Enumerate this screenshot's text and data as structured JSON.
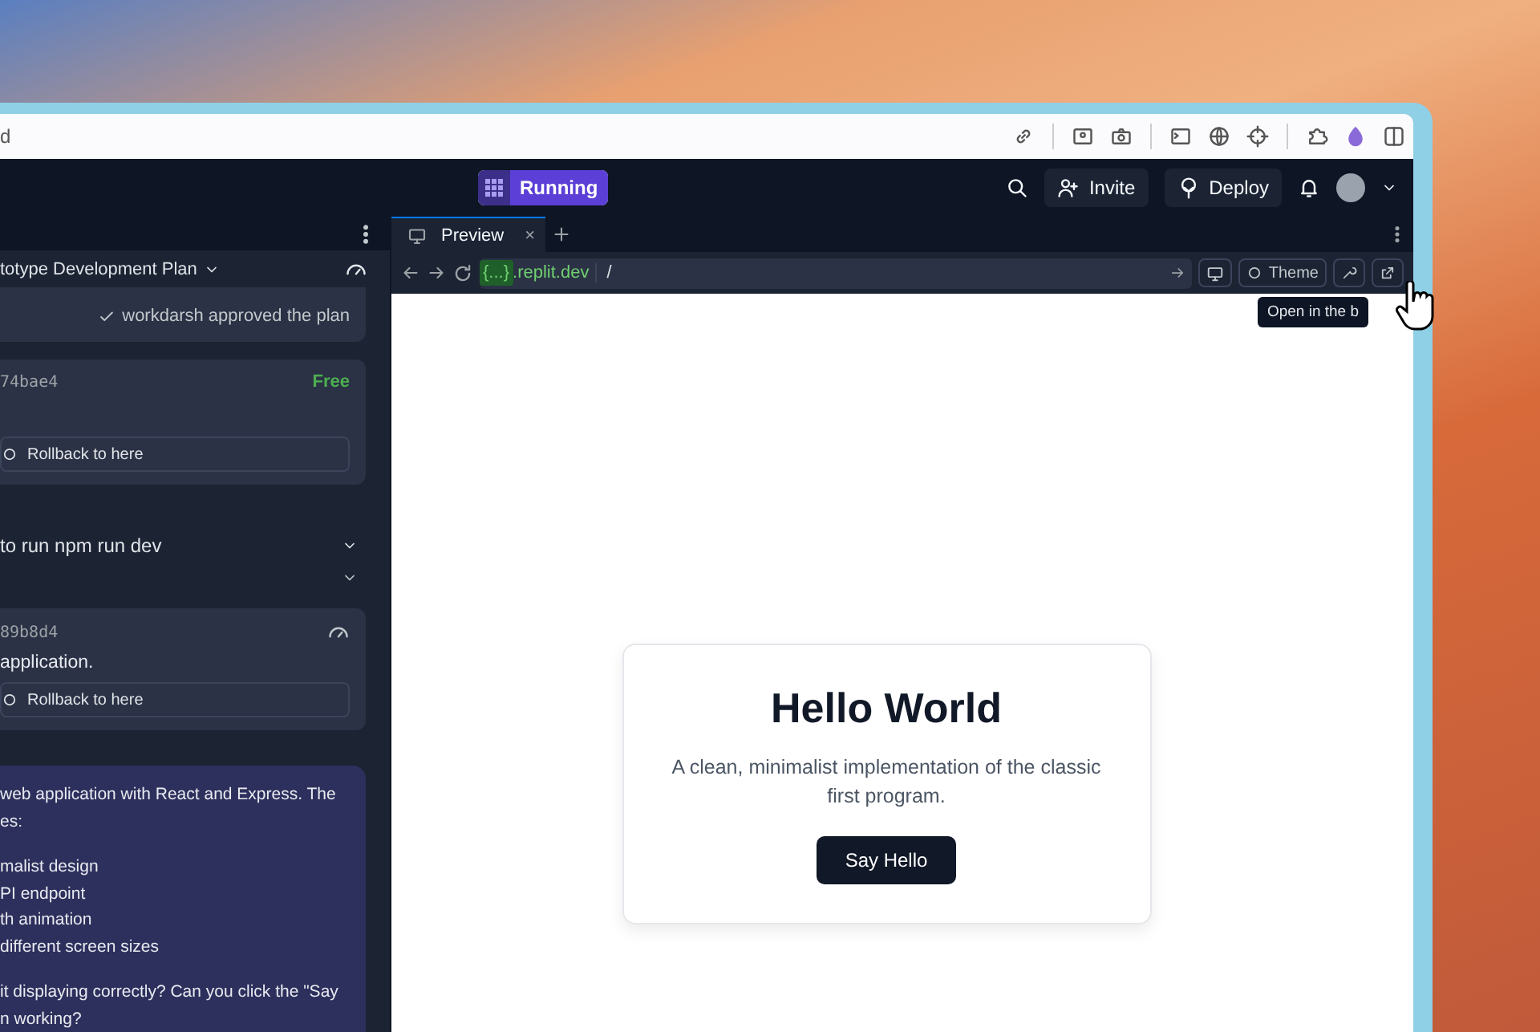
{
  "browser_toolbar": {
    "title": "d"
  },
  "header": {
    "run_button": {
      "label": "Running",
      "running": true
    },
    "invite": "Invite",
    "deploy": "Deploy"
  },
  "chat": {
    "plan_title": "totype Development Plan",
    "approval": "workdarsh approved the plan",
    "checkpoints": [
      {
        "id": "74bae4",
        "badge": "Free",
        "action": "Rollback to here"
      }
    ],
    "command": "to run npm run dev",
    "checkpoint_2": {
      "id": "89b8d4",
      "text": "application.",
      "action": "Rollback to here"
    },
    "message": {
      "intro": "web application with React and Express. The",
      "intro_end": "es:",
      "items": [
        "malist design",
        "PI endpoint",
        "th animation",
        "different screen sizes"
      ],
      "question": "it displaying correctly? Can you click the \"Say",
      "question_end": "n working?"
    }
  },
  "preview": {
    "tabs": [
      {
        "label": "Preview",
        "selected": true,
        "close": "×"
      }
    ],
    "url_host": "{...}",
    "url_domain": ".replit.dev",
    "url_path": "/",
    "theme_button": "Theme",
    "tooltip": "Open in the b",
    "page": {
      "heading": "Hello World",
      "text": "A clean, minimalist implementation of the classic first program.",
      "button": "Say Hello"
    }
  }
}
